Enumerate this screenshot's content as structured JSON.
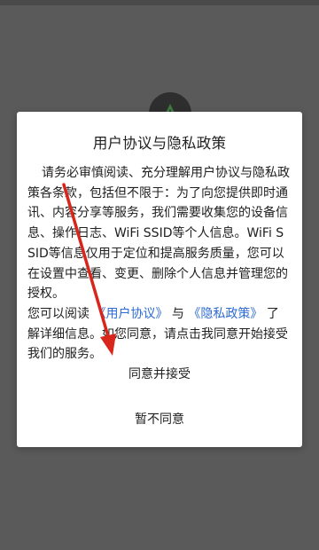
{
  "dialog": {
    "title": "用户协议与隐私政策",
    "body_paragraph_1": "请务必审慎阅读、充分理解用户协议与隐私政策各条款，包括但不限于：为了向您提供即时通讯、内容分享等服务，我们需要收集您的设备信息、操作日志、WiFi SSID等个人信息。WiFi SSID等信息仅用于定位和提高服务质量，您可以在设置中查看、变更、删除个人信息并管理您的授权。",
    "body_p2_prefix": "您可以阅读",
    "link_user_agreement": "《用户协议》",
    "body_p2_and": "与",
    "link_privacy_policy": "《隐私政策》",
    "body_p2_suffix": "了解详细信息。如您同意，请点击我同意开始接受我们的服务。",
    "agree_button": "同意并接受",
    "decline_button": "暂不同意"
  },
  "colors": {
    "overlay": "#5a5a5a",
    "dialog_bg": "#ffffff",
    "link": "#2d6bd6",
    "annotation_arrow": "#d9261c"
  },
  "icons": {
    "app_logo": "app-logo-icon",
    "annotation": "red-arrow-annotation"
  }
}
